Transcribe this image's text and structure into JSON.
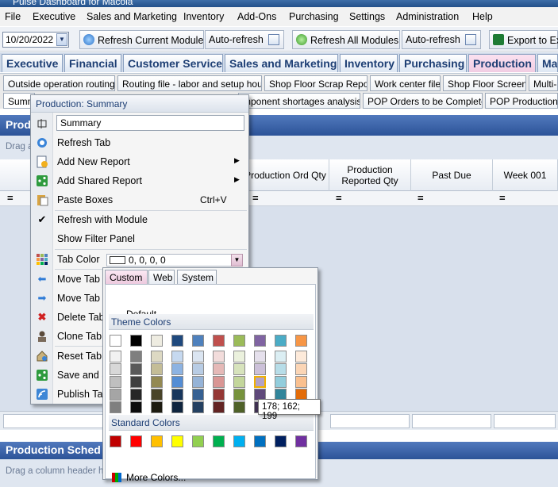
{
  "window": {
    "title": "Pulse Dashboard for Macola"
  },
  "menu": [
    "File",
    "Executive",
    "Sales and Marketing",
    "Inventory",
    "Add-Ons",
    "Purchasing",
    "Settings",
    "Administration",
    "Help"
  ],
  "toolbar": {
    "date": "10/20/2022",
    "refresh_module": "Refresh Current Module",
    "auto_refresh1": "Auto-refresh",
    "refresh_all": "Refresh All Modules",
    "auto_refresh2": "Auto-refresh",
    "export": "Export to Ex"
  },
  "main_tabs": [
    "Executive",
    "Financial",
    "Customer Service",
    "Sales and Marketing",
    "Inventory",
    "Purchasing",
    "Production",
    "Ma"
  ],
  "sub_tabs1": [
    "Outside operation routings",
    "Routing file - labor and setup hours",
    "Shop Floor Scrap Report",
    "Work center file",
    "Shop Floor Screens",
    "Multi-L"
  ],
  "sub_tabs2": [
    "Summ",
    "mponent shortages analysis",
    "POP Orders to be Completed",
    "POP Production Co"
  ],
  "panel": {
    "title": "Produ",
    "drag_hint": "Drag a"
  },
  "grid": {
    "columns": [
      "Production Ord Qty",
      "Production Reported Qty",
      "Past Due",
      "Week 001"
    ],
    "filter_symbol": "="
  },
  "panel2": {
    "title": "Production Sched",
    "drag_hint": "Drag a column header he"
  },
  "context_menu": {
    "header": "Production: Summary",
    "name_value": "Summary",
    "items": [
      {
        "label": "Refresh Tab",
        "icon": "refresh-icon"
      },
      {
        "label": "Add New Report",
        "icon": "add-report-icon",
        "submenu": true
      },
      {
        "label": "Add Shared Report",
        "icon": "share-icon",
        "submenu": true
      },
      {
        "label": "Paste Boxes",
        "icon": "paste-icon",
        "shortcut": "Ctrl+V"
      },
      {
        "label": "Refresh with Module",
        "icon": "checkmark-icon"
      },
      {
        "label": "Show Filter Panel",
        "icon": ""
      },
      {
        "label": "Tab Color",
        "icon": "palette-icon",
        "value": "0, 0, 0, 0"
      },
      {
        "label": "Move Tab l",
        "icon": "arrow-left-icon"
      },
      {
        "label": "Move Tab I",
        "icon": "arrow-right-icon"
      },
      {
        "label": "Delete Tab",
        "icon": "delete-icon"
      },
      {
        "label": "Clone Tab",
        "icon": "clone-icon"
      },
      {
        "label": "Reset Tab t",
        "icon": "reset-icon"
      },
      {
        "label": "Save and S",
        "icon": "share-icon"
      },
      {
        "label": "Publish Tab",
        "icon": "publish-icon"
      }
    ]
  },
  "color_picker": {
    "tabs": [
      "Custom",
      "Web",
      "System"
    ],
    "default_label": "Default",
    "theme_label": "Theme Colors",
    "standard_label": "Standard Colors",
    "more_label": "More Colors...",
    "theme_top": [
      "#ffffff",
      "#000000",
      "#eeece1",
      "#1f497d",
      "#4f81bd",
      "#c0504d",
      "#9bbb59",
      "#8064a2",
      "#4bacc6",
      "#f79646"
    ],
    "theme_shades": [
      [
        "#f2f2f2",
        "#7f7f7f",
        "#ddd9c3",
        "#c6d9f0",
        "#dbe5f1",
        "#f2dcdb",
        "#ebf1dd",
        "#e5e0ec",
        "#dbeef3",
        "#fdeada"
      ],
      [
        "#d8d8d8",
        "#595959",
        "#c4bd97",
        "#8db3e2",
        "#b8cce4",
        "#e5b9b7",
        "#d7e3bc",
        "#ccc1d9",
        "#b7dde8",
        "#fbd5b5"
      ],
      [
        "#bfbfbf",
        "#3f3f3f",
        "#938953",
        "#548dd4",
        "#95b3d7",
        "#d99694",
        "#c3d69b",
        "#b2a2c7",
        "#92cddc",
        "#fac08f"
      ],
      [
        "#a5a5a5",
        "#262626",
        "#494429",
        "#17365d",
        "#366092",
        "#953734",
        "#76923c",
        "#5f497a",
        "#31859b",
        "#e36c09"
      ],
      [
        "#7f7f7f",
        "#0c0c0c",
        "#1d1b10",
        "#0f243e",
        "#244061",
        "#632423",
        "#4f6128",
        "#3f3151",
        "#205867",
        "#974806"
      ]
    ],
    "standard": [
      "#c00000",
      "#ff0000",
      "#ffc000",
      "#ffff00",
      "#92d050",
      "#00b050",
      "#00b0f0",
      "#0070c0",
      "#002060",
      "#7030a0"
    ],
    "tooltip": "178; 162; 199"
  }
}
